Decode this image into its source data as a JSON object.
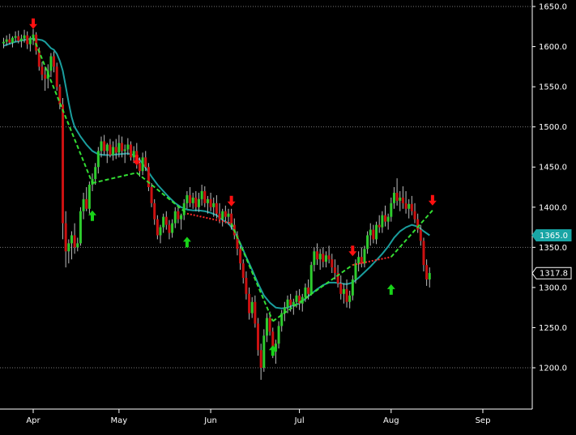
{
  "chart_data": {
    "type": "candlestick",
    "title": "",
    "xlabel": "",
    "ylabel": "",
    "ylim": [
      1150,
      1655
    ],
    "y_ticks": [
      "1650.0",
      "1600.0",
      "1550.0",
      "1500.0",
      "1450.0",
      "1400.0",
      "1350.0",
      "1300.0",
      "1250.0",
      "1200.0"
    ],
    "x_ticks": [
      {
        "label": "Apr",
        "day": 14
      },
      {
        "label": "May",
        "day": 43
      },
      {
        "label": "Jun",
        "day": 74
      },
      {
        "label": "Jul",
        "day": 104
      },
      {
        "label": "Aug",
        "day": 135
      },
      {
        "label": "Sep",
        "day": 166
      }
    ],
    "x_range": [
      4,
      180
    ],
    "grid": true,
    "colors": {
      "up": "#2ecc2e",
      "down": "#cc1111",
      "ma": "#1a9e9e",
      "zigzag_up": "#33dd33",
      "zigzag_down": "#ff2a2a",
      "arrow_up": "#18d418",
      "arrow_down": "#ff1010",
      "grid": "#7a7a7a",
      "axis": "#ffffff"
    },
    "price_labels": [
      {
        "text": "1365.0",
        "value": 1365,
        "bg": "#19a5a5"
      },
      {
        "text": "1317.8",
        "value": 1317.8,
        "bg": "#000000"
      }
    ],
    "candles": [
      [
        4,
        1604,
        1611,
        1598,
        1606
      ],
      [
        5,
        1606,
        1614,
        1601,
        1609
      ],
      [
        6,
        1609,
        1616,
        1603,
        1605
      ],
      [
        7,
        1605,
        1613,
        1599,
        1611
      ],
      [
        8,
        1611,
        1619,
        1606,
        1613
      ],
      [
        9,
        1613,
        1620,
        1604,
        1607
      ],
      [
        10,
        1607,
        1615,
        1599,
        1610
      ],
      [
        11,
        1610,
        1621,
        1605,
        1614
      ],
      [
        12,
        1614,
        1619,
        1597,
        1603
      ],
      [
        13,
        1603,
        1613,
        1594,
        1611
      ],
      [
        14,
        1611,
        1622,
        1602,
        1615
      ],
      [
        15,
        1615,
        1618,
        1590,
        1595
      ],
      [
        16,
        1595,
        1599,
        1570,
        1575
      ],
      [
        17,
        1575,
        1581,
        1558,
        1565
      ],
      [
        18,
        1565,
        1575,
        1545,
        1560
      ],
      [
        19,
        1560,
        1578,
        1548,
        1570
      ],
      [
        20,
        1570,
        1592,
        1562,
        1588
      ],
      [
        21,
        1588,
        1594,
        1568,
        1575
      ],
      [
        22,
        1575,
        1580,
        1545,
        1550
      ],
      [
        23,
        1550,
        1553,
        1522,
        1528
      ],
      [
        24,
        1528,
        1536,
        1360,
        1380
      ],
      [
        25,
        1380,
        1395,
        1325,
        1345
      ],
      [
        26,
        1345,
        1360,
        1330,
        1355
      ],
      [
        27,
        1355,
        1370,
        1335,
        1365
      ],
      [
        28,
        1365,
        1380,
        1342,
        1350
      ],
      [
        29,
        1350,
        1362,
        1345,
        1355
      ],
      [
        30,
        1355,
        1400,
        1352,
        1395
      ],
      [
        31,
        1395,
        1418,
        1385,
        1410
      ],
      [
        32,
        1410,
        1425,
        1395,
        1398
      ],
      [
        33,
        1398,
        1432,
        1392,
        1428
      ],
      [
        34,
        1428,
        1442,
        1420,
        1435
      ],
      [
        35,
        1435,
        1455,
        1428,
        1450
      ],
      [
        36,
        1450,
        1475,
        1442,
        1470
      ],
      [
        37,
        1470,
        1488,
        1462,
        1482
      ],
      [
        38,
        1482,
        1490,
        1465,
        1470
      ],
      [
        39,
        1470,
        1480,
        1455,
        1478
      ],
      [
        40,
        1478,
        1485,
        1462,
        1465
      ],
      [
        41,
        1465,
        1482,
        1458,
        1475
      ],
      [
        42,
        1475,
        1485,
        1460,
        1468
      ],
      [
        43,
        1468,
        1490,
        1462,
        1480
      ],
      [
        44,
        1480,
        1488,
        1462,
        1470
      ],
      [
        45,
        1470,
        1478,
        1455,
        1472
      ],
      [
        46,
        1472,
        1486,
        1465,
        1478
      ],
      [
        47,
        1478,
        1482,
        1458,
        1462
      ],
      [
        48,
        1462,
        1476,
        1455,
        1470
      ],
      [
        49,
        1470,
        1480,
        1448,
        1455
      ],
      [
        50,
        1455,
        1462,
        1438,
        1445
      ],
      [
        51,
        1445,
        1468,
        1440,
        1462
      ],
      [
        52,
        1462,
        1470,
        1445,
        1450
      ],
      [
        53,
        1450,
        1455,
        1420,
        1425
      ],
      [
        54,
        1425,
        1430,
        1400,
        1405
      ],
      [
        55,
        1405,
        1410,
        1378,
        1385
      ],
      [
        56,
        1385,
        1390,
        1360,
        1365
      ],
      [
        57,
        1365,
        1378,
        1355,
        1375
      ],
      [
        58,
        1375,
        1392,
        1368,
        1388
      ],
      [
        59,
        1388,
        1395,
        1372,
        1378
      ],
      [
        60,
        1378,
        1384,
        1360,
        1368
      ],
      [
        61,
        1368,
        1385,
        1362,
        1380
      ],
      [
        62,
        1380,
        1400,
        1374,
        1395
      ],
      [
        63,
        1395,
        1400,
        1380,
        1385
      ],
      [
        64,
        1385,
        1392,
        1372,
        1390
      ],
      [
        65,
        1390,
        1410,
        1384,
        1405
      ],
      [
        66,
        1405,
        1420,
        1398,
        1415
      ],
      [
        67,
        1415,
        1425,
        1400,
        1405
      ],
      [
        68,
        1405,
        1418,
        1398,
        1412
      ],
      [
        69,
        1412,
        1420,
        1395,
        1400
      ],
      [
        70,
        1400,
        1418,
        1394,
        1410
      ],
      [
        71,
        1410,
        1428,
        1402,
        1420
      ],
      [
        72,
        1420,
        1426,
        1400,
        1405
      ],
      [
        73,
        1405,
        1414,
        1392,
        1410
      ],
      [
        74,
        1410,
        1418,
        1395,
        1400
      ],
      [
        75,
        1400,
        1412,
        1388,
        1405
      ],
      [
        76,
        1405,
        1415,
        1386,
        1392
      ],
      [
        77,
        1392,
        1405,
        1380,
        1385
      ],
      [
        78,
        1385,
        1398,
        1376,
        1395
      ],
      [
        79,
        1395,
        1402,
        1380,
        1388
      ],
      [
        80,
        1388,
        1398,
        1378,
        1392
      ],
      [
        81,
        1392,
        1398,
        1372,
        1378
      ],
      [
        82,
        1378,
        1386,
        1360,
        1365
      ],
      [
        83,
        1365,
        1370,
        1340,
        1348
      ],
      [
        84,
        1348,
        1352,
        1322,
        1330
      ],
      [
        85,
        1330,
        1335,
        1305,
        1312
      ],
      [
        86,
        1312,
        1320,
        1285,
        1292
      ],
      [
        87,
        1292,
        1300,
        1260,
        1268
      ],
      [
        88,
        1268,
        1288,
        1262,
        1282
      ],
      [
        89,
        1282,
        1290,
        1250,
        1255
      ],
      [
        90,
        1255,
        1262,
        1215,
        1222
      ],
      [
        91,
        1222,
        1230,
        1185,
        1200
      ],
      [
        92,
        1200,
        1248,
        1195,
        1240
      ],
      [
        93,
        1240,
        1268,
        1232,
        1262
      ],
      [
        94,
        1262,
        1270,
        1240,
        1245
      ],
      [
        95,
        1245,
        1250,
        1212,
        1220
      ],
      [
        96,
        1220,
        1235,
        1205,
        1230
      ],
      [
        97,
        1230,
        1258,
        1224,
        1252
      ],
      [
        98,
        1252,
        1272,
        1245,
        1268
      ],
      [
        99,
        1268,
        1282,
        1258,
        1275
      ],
      [
        100,
        1275,
        1290,
        1268,
        1285
      ],
      [
        101,
        1285,
        1292,
        1270,
        1278
      ],
      [
        102,
        1278,
        1286,
        1266,
        1282
      ],
      [
        103,
        1282,
        1296,
        1275,
        1290
      ],
      [
        104,
        1290,
        1298,
        1272,
        1280
      ],
      [
        105,
        1280,
        1292,
        1270,
        1288
      ],
      [
        106,
        1288,
        1305,
        1282,
        1300
      ],
      [
        107,
        1300,
        1310,
        1285,
        1292
      ],
      [
        108,
        1292,
        1332,
        1290,
        1328
      ],
      [
        109,
        1328,
        1350,
        1320,
        1345
      ],
      [
        110,
        1345,
        1355,
        1328,
        1335
      ],
      [
        111,
        1335,
        1348,
        1322,
        1342
      ],
      [
        112,
        1342,
        1350,
        1325,
        1332
      ],
      [
        113,
        1332,
        1345,
        1325,
        1340
      ],
      [
        114,
        1340,
        1352,
        1330,
        1335
      ],
      [
        115,
        1335,
        1342,
        1318,
        1325
      ],
      [
        116,
        1325,
        1335,
        1310,
        1318
      ],
      [
        117,
        1318,
        1328,
        1300,
        1305
      ],
      [
        118,
        1305,
        1315,
        1285,
        1292
      ],
      [
        119,
        1292,
        1305,
        1280,
        1298
      ],
      [
        120,
        1298,
        1310,
        1275,
        1282
      ],
      [
        121,
        1282,
        1296,
        1274,
        1290
      ],
      [
        122,
        1290,
        1315,
        1284,
        1310
      ],
      [
        123,
        1310,
        1335,
        1305,
        1330
      ],
      [
        124,
        1330,
        1345,
        1320,
        1338
      ],
      [
        125,
        1338,
        1350,
        1325,
        1330
      ],
      [
        126,
        1330,
        1352,
        1325,
        1348
      ],
      [
        127,
        1348,
        1370,
        1342,
        1365
      ],
      [
        128,
        1365,
        1380,
        1352,
        1372
      ],
      [
        129,
        1372,
        1378,
        1355,
        1360
      ],
      [
        130,
        1360,
        1382,
        1354,
        1378
      ],
      [
        131,
        1378,
        1390,
        1368,
        1375
      ],
      [
        132,
        1375,
        1395,
        1368,
        1390
      ],
      [
        133,
        1390,
        1402,
        1376,
        1382
      ],
      [
        134,
        1382,
        1392,
        1372,
        1388
      ],
      [
        135,
        1388,
        1412,
        1382,
        1405
      ],
      [
        136,
        1405,
        1425,
        1398,
        1418
      ],
      [
        137,
        1418,
        1436,
        1402,
        1408
      ],
      [
        138,
        1408,
        1420,
        1395,
        1412
      ],
      [
        139,
        1412,
        1426,
        1398,
        1405
      ],
      [
        140,
        1405,
        1420,
        1392,
        1398
      ],
      [
        141,
        1398,
        1410,
        1386,
        1404
      ],
      [
        142,
        1404,
        1414,
        1390,
        1395
      ],
      [
        143,
        1395,
        1405,
        1380,
        1385
      ],
      [
        144,
        1385,
        1392,
        1368,
        1372
      ],
      [
        145,
        1372,
        1378,
        1352,
        1358
      ],
      [
        146,
        1358,
        1362,
        1320,
        1328
      ],
      [
        147,
        1328,
        1335,
        1302,
        1310
      ],
      [
        148,
        1310,
        1325,
        1300,
        1318
      ]
    ],
    "moving_average": [
      [
        4,
        1601
      ],
      [
        8,
        1606
      ],
      [
        12,
        1609
      ],
      [
        14,
        1610
      ],
      [
        17,
        1608
      ],
      [
        18,
        1606
      ],
      [
        19,
        1602
      ],
      [
        20,
        1598
      ],
      [
        21,
        1596
      ],
      [
        22,
        1591
      ],
      [
        23,
        1582
      ],
      [
        24,
        1570
      ],
      [
        25,
        1550
      ],
      [
        26,
        1530
      ],
      [
        27,
        1512
      ],
      [
        28,
        1500
      ],
      [
        30,
        1488
      ],
      [
        32,
        1478
      ],
      [
        34,
        1470
      ],
      [
        36,
        1466
      ],
      [
        38,
        1465
      ],
      [
        40,
        1465
      ],
      [
        43,
        1466
      ],
      [
        46,
        1467
      ],
      [
        48,
        1465
      ],
      [
        50,
        1459
      ],
      [
        52,
        1449
      ],
      [
        54,
        1438
      ],
      [
        56,
        1428
      ],
      [
        58,
        1420
      ],
      [
        60,
        1412
      ],
      [
        62,
        1405
      ],
      [
        64,
        1400
      ],
      [
        66,
        1397
      ],
      [
        68,
        1396
      ],
      [
        70,
        1396
      ],
      [
        72,
        1395
      ],
      [
        74,
        1393
      ],
      [
        76,
        1390
      ],
      [
        78,
        1384
      ],
      [
        80,
        1380
      ],
      [
        82,
        1370
      ],
      [
        84,
        1355
      ],
      [
        86,
        1338
      ],
      [
        88,
        1322
      ],
      [
        90,
        1305
      ],
      [
        92,
        1290
      ],
      [
        94,
        1281
      ],
      [
        96,
        1275
      ],
      [
        98,
        1274
      ],
      [
        100,
        1275
      ],
      [
        102,
        1278
      ],
      [
        104,
        1280
      ],
      [
        106,
        1286
      ],
      [
        108,
        1292
      ],
      [
        110,
        1298
      ],
      [
        112,
        1303
      ],
      [
        114,
        1306
      ],
      [
        116,
        1306
      ],
      [
        118,
        1305
      ],
      [
        120,
        1304
      ],
      [
        122,
        1306
      ],
      [
        124,
        1312
      ],
      [
        126,
        1319
      ],
      [
        128,
        1326
      ],
      [
        130,
        1334
      ],
      [
        132,
        1342
      ],
      [
        134,
        1351
      ],
      [
        136,
        1362
      ],
      [
        138,
        1370
      ],
      [
        140,
        1375
      ],
      [
        142,
        1378
      ],
      [
        144,
        1376
      ],
      [
        146,
        1370
      ],
      [
        148,
        1365
      ]
    ],
    "zigzag": [
      {
        "points": [
          [
            14,
            1612
          ],
          [
            34,
            1430
          ]
        ],
        "color": "zigzag_up",
        "style": "dashed"
      },
      {
        "points": [
          [
            34,
            1430
          ],
          [
            49,
            1443
          ]
        ],
        "color": "zigzag_up",
        "style": "dashed"
      },
      {
        "points": [
          [
            49,
            1443
          ],
          [
            66,
            1392
          ]
        ],
        "color": "zigzag_up",
        "style": "dashed"
      },
      {
        "points": [
          [
            66,
            1392
          ],
          [
            81,
            1380
          ]
        ],
        "color": "zigzag_down",
        "style": "dotted"
      },
      {
        "points": [
          [
            81,
            1380
          ],
          [
            95,
            1258
          ]
        ],
        "color": "zigzag_up",
        "style": "dashed"
      },
      {
        "points": [
          [
            95,
            1258
          ],
          [
            122,
            1328
          ]
        ],
        "color": "zigzag_up",
        "style": "dashed"
      },
      {
        "points": [
          [
            122,
            1328
          ],
          [
            135,
            1338
          ]
        ],
        "color": "zigzag_down",
        "style": "dotted"
      },
      {
        "points": [
          [
            135,
            1338
          ],
          [
            149,
            1396
          ]
        ],
        "color": "zigzag_up",
        "style": "dashed"
      }
    ],
    "arrows": [
      {
        "day": 14,
        "value": 1628,
        "dir": "down"
      },
      {
        "day": 49,
        "value": 1458,
        "dir": "down"
      },
      {
        "day": 81,
        "value": 1407,
        "dir": "down"
      },
      {
        "day": 122,
        "value": 1345,
        "dir": "down"
      },
      {
        "day": 149,
        "value": 1408,
        "dir": "down"
      },
      {
        "day": 34,
        "value": 1390,
        "dir": "up"
      },
      {
        "day": 66,
        "value": 1357,
        "dir": "up"
      },
      {
        "day": 95,
        "value": 1222,
        "dir": "up"
      },
      {
        "day": 135,
        "value": 1298,
        "dir": "up"
      }
    ]
  }
}
